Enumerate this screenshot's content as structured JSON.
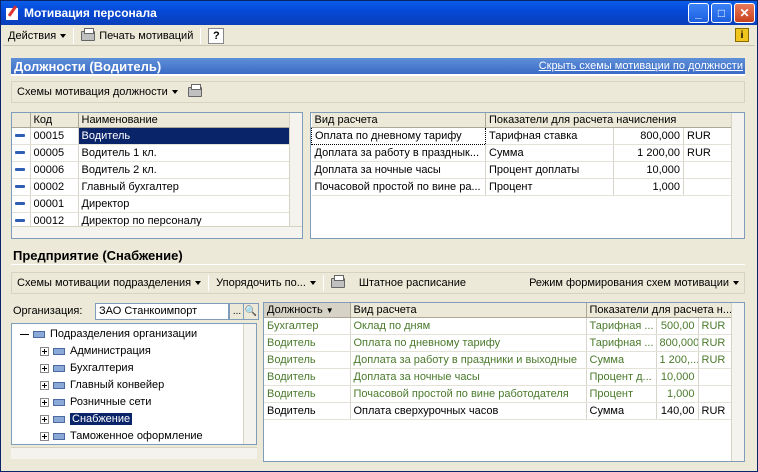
{
  "window": {
    "title": "Мотивация персонала"
  },
  "toolbar": {
    "actions": "Действия",
    "print": "Печать мотиваций",
    "help": "?",
    "info": "i"
  },
  "section1": {
    "title": "Должности (Водитель)",
    "link": "Скрыть схемы мотивации по должности",
    "subbar": "Схемы мотивация должности"
  },
  "positions": {
    "columns": [
      "Код",
      "Наименование"
    ],
    "rows": [
      {
        "code": "00015",
        "name": "Водитель"
      },
      {
        "code": "00005",
        "name": "Водитель 1 кл."
      },
      {
        "code": "00006",
        "name": "Водитель 2 кл."
      },
      {
        "code": "00002",
        "name": "Главный бухгалтер"
      },
      {
        "code": "00001",
        "name": "Директор"
      },
      {
        "code": "00012",
        "name": "Директор по персоналу"
      }
    ]
  },
  "calc1": {
    "columns": [
      "Вид расчета",
      "Показатели для расчета начисления"
    ],
    "rows": [
      {
        "type": "Оплата по дневному тарифу",
        "indicator": "Тарифная ставка",
        "value": "800,000",
        "unit": "RUR"
      },
      {
        "type": "Доплата за работу в празднык...",
        "indicator": "Сумма",
        "value": "1 200,00",
        "unit": "RUR"
      },
      {
        "type": "Доплата за ночные часы",
        "indicator": "Процент доплаты",
        "value": "10,000",
        "unit": ""
      },
      {
        "type": "Почасовой простой по вине ра...",
        "indicator": "Процент",
        "value": "1,000",
        "unit": ""
      }
    ]
  },
  "section2": {
    "title": "Предприятие (Снабжение)",
    "subbar_schemes": "Схемы мотивации подразделения",
    "subbar_order": "Упорядочить по...",
    "subbar_staff": "Штатное расписание",
    "subbar_mode": "Режим формирования схем мотивации"
  },
  "org": {
    "label": "Организация:",
    "value": "ЗАО Станкоимпорт",
    "dots": "...",
    "search": "🔍"
  },
  "tree": {
    "root": "Подразделения организации",
    "items": [
      "Администрация",
      "Бухгалтерия",
      "Главный конвейер",
      "Розничные сети",
      "Снабжение",
      "Таможенное оформление"
    ]
  },
  "calc2": {
    "columns": [
      "Должность",
      "Вид расчета",
      "Показатели для расчета н..."
    ],
    "rows": [
      {
        "pos": "Бухгалтер",
        "type": "Оклад по дням",
        "indicator": "Тарифная ...",
        "value": "500,00",
        "unit": "RUR",
        "green": true
      },
      {
        "pos": "Водитель",
        "type": "Оплата по дневному тарифу",
        "indicator": "Тарифная ...",
        "value": "800,000",
        "unit": "RUR",
        "green": true
      },
      {
        "pos": "Водитель",
        "type": "Доплата за работу в праздники и выходные",
        "indicator": "Сумма",
        "value": "1 200,...",
        "unit": "RUR",
        "green": true
      },
      {
        "pos": "Водитель",
        "type": "Доплата за ночные часы",
        "indicator": "Процент д...",
        "value": "10,000",
        "unit": "",
        "green": true
      },
      {
        "pos": "Водитель",
        "type": "Почасовой простой по вине работодателя",
        "indicator": "Процент",
        "value": "1,000",
        "unit": "",
        "green": true
      },
      {
        "pos": "Водитель",
        "type": "Оплата сверхурочных часов",
        "indicator": "Сумма",
        "value": "140,00",
        "unit": "RUR",
        "green": false
      }
    ]
  }
}
